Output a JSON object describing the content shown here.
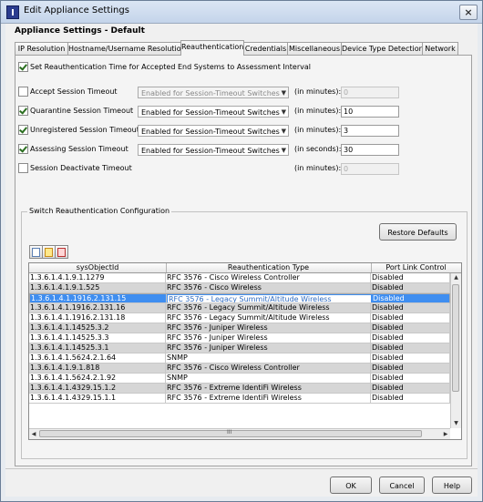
{
  "window": {
    "title": "Edit Appliance Settings",
    "close_glyph": "×"
  },
  "heading": "Appliance Settings - Default",
  "tabs": [
    {
      "label": "IP Resolution"
    },
    {
      "label": "Hostname/Username Resolution"
    },
    {
      "label": "Reauthentication",
      "active": true
    },
    {
      "label": "Credentials"
    },
    {
      "label": "Miscellaneous"
    },
    {
      "label": "Device Type Detection"
    },
    {
      "label": "Network"
    }
  ],
  "reauth": {
    "set_interval_label": "Set Reauthentication Time for Accepted End Systems to Assessment Interval",
    "set_interval_checked": true
  },
  "timeouts": [
    {
      "label": "Accept Session Timeout",
      "checked": false,
      "mode": "Enabled for Session-Timeout Switches",
      "mode_enabled": false,
      "unit": "(in minutes):",
      "value": "0",
      "value_enabled": false
    },
    {
      "label": "Quarantine Session Timeout",
      "checked": true,
      "mode": "Enabled for Session-Timeout Switches",
      "mode_enabled": true,
      "unit": "(in minutes):",
      "value": "10",
      "value_enabled": true
    },
    {
      "label": "Unregistered Session Timeout",
      "checked": true,
      "mode": "Enabled for Session-Timeout Switches",
      "mode_enabled": true,
      "unit": "(in minutes):",
      "value": "3",
      "value_enabled": true
    },
    {
      "label": "Assessing Session Timeout",
      "checked": true,
      "mode": "Enabled for Session-Timeout Switches",
      "mode_enabled": true,
      "unit": "(in seconds):",
      "value": "30",
      "value_enabled": true
    },
    {
      "label": "Session Deactivate Timeout",
      "checked": false,
      "unit": "(in minutes):",
      "value": "0",
      "value_enabled": false
    }
  ],
  "switch_group": {
    "legend": "Switch Reauthentication Configuration",
    "restore_label": "Restore Defaults",
    "toolbar": [
      "add-icon",
      "edit-icon",
      "delete-icon"
    ],
    "columns": [
      "sysObjectId",
      "Reauthentication Type",
      "Port Link Control"
    ],
    "rows": [
      [
        "1.3.6.1.4.1.9.1.1279",
        "RFC 3576 - Cisco Wireless Controller",
        "Disabled"
      ],
      [
        "1.3.6.1.4.1.9.1.525",
        "RFC 3576 - Cisco Wireless",
        "Disabled"
      ],
      [
        "1.3.6.1.4.1.1916.2.131.15",
        "RFC 3576 - Legacy Summit/Altitude Wireless",
        "Disabled"
      ],
      [
        "1.3.6.1.4.1.1916.2.131.16",
        "RFC 3576 - Legacy Summit/Altitude Wireless",
        "Disabled"
      ],
      [
        "1.3.6.1.4.1.1916.2.131.18",
        "RFC 3576 - Legacy Summit/Altitude Wireless",
        "Disabled"
      ],
      [
        "1.3.6.1.4.1.14525.3.2",
        "RFC 3576 - Juniper Wireless",
        "Disabled"
      ],
      [
        "1.3.6.1.4.1.14525.3.3",
        "RFC 3576 - Juniper Wireless",
        "Disabled"
      ],
      [
        "1.3.6.1.4.1.14525.3.1",
        "RFC 3576 - Juniper Wireless",
        "Disabled"
      ],
      [
        "1.3.6.1.4.1.5624.2.1.64",
        "SNMP",
        "Disabled"
      ],
      [
        "1.3.6.1.4.1.9.1.818",
        "RFC 3576 - Cisco Wireless Controller",
        "Disabled"
      ],
      [
        "1.3.6.1.4.1.5624.2.1.92",
        "SNMP",
        "Disabled"
      ],
      [
        "1.3.6.1.4.1.4329.15.1.2",
        "RFC 3576 - Extreme IdentiFi Wireless",
        "Disabled"
      ],
      [
        "1.3.6.1.4.1.4329.15.1.1",
        "RFC 3576 - Extreme IdentiFi Wireless",
        "Disabled"
      ]
    ],
    "selected_row": 2,
    "scroll_thumb_glyph": "III"
  },
  "buttons": {
    "ok": "OK",
    "cancel": "Cancel",
    "help": "Help"
  }
}
